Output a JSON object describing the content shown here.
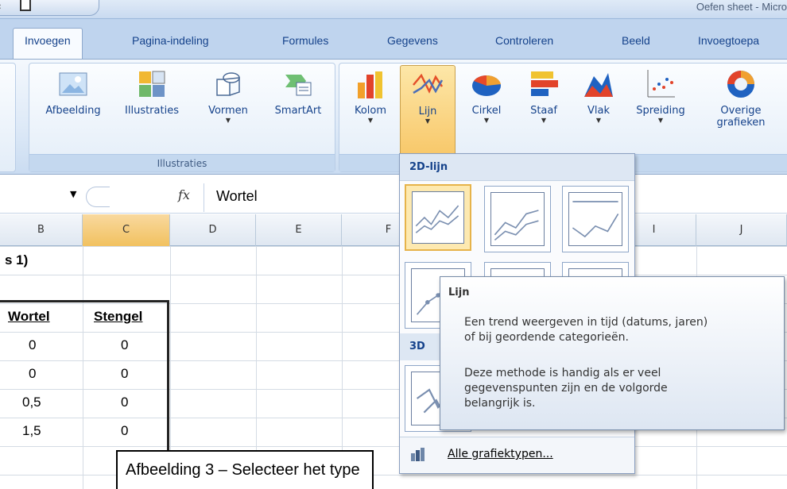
{
  "window": {
    "title": "Oefen sheet - Micro"
  },
  "tabs": [
    "Invoegen",
    "Pagina-indeling",
    "Formules",
    "Gegevens",
    "Controleren",
    "Beeld",
    "Invoegtoepa"
  ],
  "ribbon": {
    "illustraties": {
      "label": "Illustraties",
      "buttons": [
        {
          "label": "Afbeelding"
        },
        {
          "label": "Illustraties"
        },
        {
          "label": "Vormen"
        },
        {
          "label": "SmartArt"
        }
      ]
    },
    "grafieken": {
      "buttons": [
        {
          "label": "Kolom"
        },
        {
          "label": "Lijn"
        },
        {
          "label": "Cirkel"
        },
        {
          "label": "Staaf"
        },
        {
          "label": "Vlak"
        },
        {
          "label": "Spreiding"
        },
        {
          "label": "Overige",
          "label2": "grafieken"
        }
      ]
    }
  },
  "formula_bar": {
    "fx": "fx",
    "value": "Wortel"
  },
  "columns": [
    "B",
    "C",
    "D",
    "E",
    "F",
    "I",
    "J"
  ],
  "sheet": {
    "row1": "s 1)",
    "headers": [
      "Wortel",
      "Stengel"
    ],
    "rows": [
      [
        "0",
        "0"
      ],
      [
        "0",
        "0"
      ],
      [
        "0,5",
        "0"
      ],
      [
        "1,5",
        "0"
      ]
    ]
  },
  "dropdown": {
    "section_2d": "2D-lijn",
    "section_3d": "3D",
    "footer": "Alle grafiektypen..."
  },
  "tooltip": {
    "title": "Lijn",
    "lines1": [
      "Een trend weergeven in tijd (datums, jaren)",
      "of bij geordende categorieën."
    ],
    "lines2": [
      "Deze methode is handig als er veel",
      "gegevenspunten zijn en de volgorde",
      "belangrijk is."
    ]
  },
  "caption": "Afbeelding 3 – Selecteer het type",
  "colors": {
    "ribbon_bg": "#dde9f7",
    "tab_text": "#15428b",
    "pressed": "#f8c86a"
  }
}
